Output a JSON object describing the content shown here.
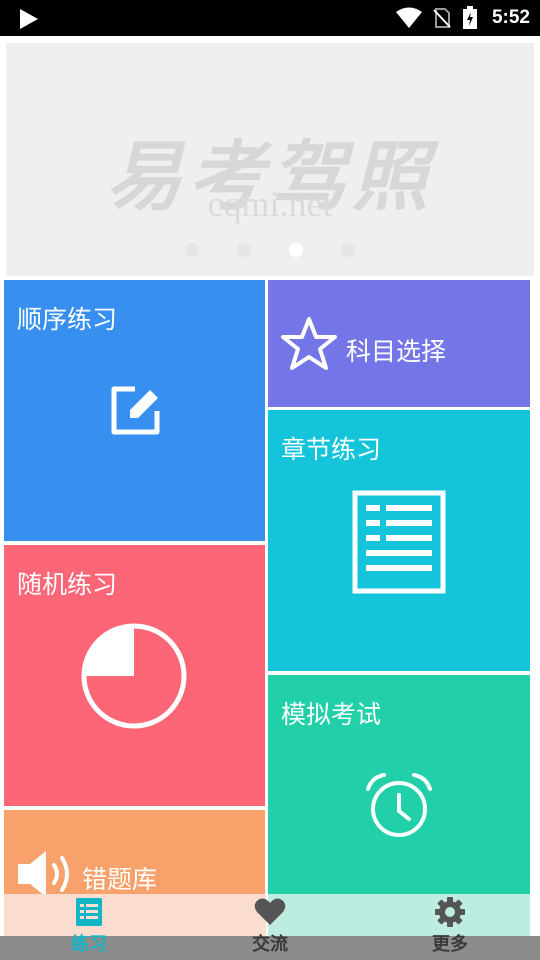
{
  "status_bar": {
    "time": "5:52",
    "icons": [
      "play-icon",
      "wifi-icon",
      "no-sim-icon",
      "battery-charging-icon"
    ]
  },
  "banner": {
    "logo_text": "易考驾照",
    "logo_url": "cqmi.net",
    "slide_count": 4,
    "active_slide": 3
  },
  "tiles": {
    "sequential": {
      "label": "顺序练习",
      "color": "#3790f0",
      "icon": "edit-icon"
    },
    "subject": {
      "label": "科目选择",
      "color": "#7476e8",
      "icon": "star-icon"
    },
    "chapter": {
      "label": "章节练习",
      "color": "#13c4db",
      "icon": "document-icon"
    },
    "random": {
      "label": "随机练习",
      "color": "#fc6677",
      "icon": "pie-chart-icon"
    },
    "mock_exam": {
      "label": "模拟考试",
      "color": "#21d0a9",
      "icon": "alarm-clock-icon"
    },
    "wrong_questions": {
      "label": "错题库",
      "color": "#f8a16b",
      "icon": "speaker-icon"
    }
  },
  "bottom_nav": {
    "items": [
      {
        "label": "练习",
        "icon": "list-icon",
        "active": true,
        "color": "#10b6c8"
      },
      {
        "label": "交流",
        "icon": "heart-icon",
        "active": false,
        "color": "#555555"
      },
      {
        "label": "更多",
        "icon": "gear-icon",
        "active": false,
        "color": "#555555"
      }
    ]
  }
}
